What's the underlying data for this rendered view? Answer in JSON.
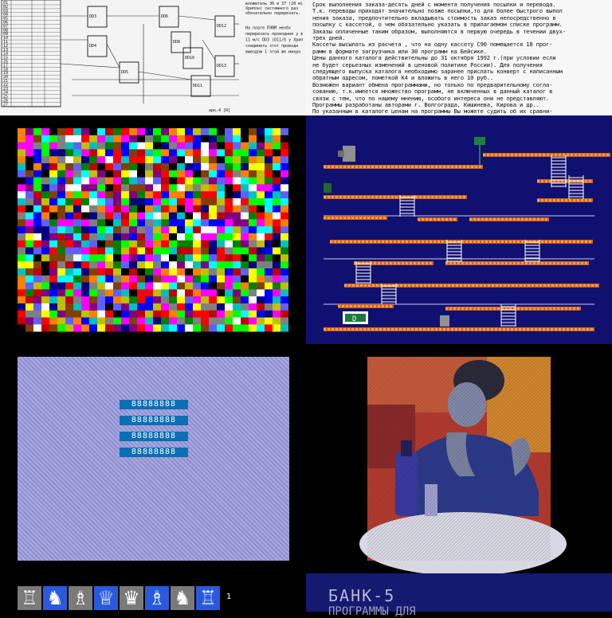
{
  "schematic": {
    "rows": [
      "01",
      "02",
      "03",
      "04",
      "05",
      "06",
      "07",
      "08",
      "09",
      "10",
      "11",
      "12",
      "13",
      "14",
      "15",
      "16",
      "17",
      "18",
      "19",
      "20",
      "21",
      "22",
      "23",
      "24",
      "25",
      "26",
      "27"
    ],
    "chips": [
      "DD3",
      "DD4",
      "DD5",
      "DD6",
      "DD8",
      "DD10",
      "DD11",
      "DD12",
      "DD13"
    ],
    "notes": [
      "вложитель 36 и 37 (20 м)",
      "Хрипон) системного раз",
      "обязательно перерезать.",
      "На плате ПЭВМ необх",
      "перерезать проводник у в",
      "11 м/с DD3 (D11/б у Хрип",
      "соединить этот проводн",
      "выводом 1 этой же микро"
    ],
    "footer": "арк.4 [R]"
  },
  "doc": {
    "lines": [
      "Срок выполнения заказа-десять дней с момента получения посылки и перевода.",
      "Т.к. переводы приходят значительно позже посылки,то для более быстрого выпол",
      "нения заказа, предпочтительно вкладывать стоимость заказ  непосредственно в",
      "посылку с кассетой, о чем обязательно указать в прилагаемом списке программ.",
      "Заказы оплаченные таким образом, выполняются в первую очередь в течении двух-",
      "трех дней.",
      "Кассеты  высылать из расчета , что на одну кассету С90 помещается 18 прог-",
      "рамм в формате загрузчика или 30 программ на Бейсике.",
      "Цены данного каталога действительны до 31 октября 1992 г.(при условии если",
      "не  будет серьезных изменений  в  ценовой политике России). Для  получения",
      "следующего выпуска каталога необходимо заранее прислать конверт с написанным",
      "обратным адресом, пометкой К4 и вложить в него 10 руб..",
      "Возможен вариант обмена программами, но только по предварительному согла-",
      "сованию, т.к.имеется множество программ, не включенных в данный  каталог  в",
      "связи с тем, что по нашему мнению, особого интереса они не представляют.",
      "Программы разработаны авторами г. Волгограда, Кишинева, Кирова и др..",
      "По указанным в каталоге ценам на программы  Вы можете судить об их сравни-"
    ]
  },
  "mosaic": {
    "palette": [
      "#0000ff",
      "#ff0000",
      "#00ff00",
      "#ffff00",
      "#ff00ff",
      "#00ffff",
      "#ffffff",
      "#000000",
      "#ff8000",
      "#804000",
      "#800080",
      "#008000",
      "#000080",
      "#808080",
      "#c00000",
      "#00c0c0",
      "#c0c000",
      "#6060ff"
    ]
  },
  "platform": {
    "door_label": "D"
  },
  "pattern": {
    "brick_text": "88888888"
  },
  "chess": {
    "pieces": [
      "♖",
      "♞",
      "♗",
      "♕",
      "♛",
      "♗",
      "♞",
      "♖"
    ],
    "page_number": "1"
  },
  "bank": {
    "title": "БАНК-5",
    "subtitle": "ПРОГРАММЫ ДЛЯ"
  },
  "colors": {
    "platform_bg": "#101070",
    "girder": "#d06020",
    "ladder": "#ffffff",
    "bank_bg": "#141a70"
  }
}
